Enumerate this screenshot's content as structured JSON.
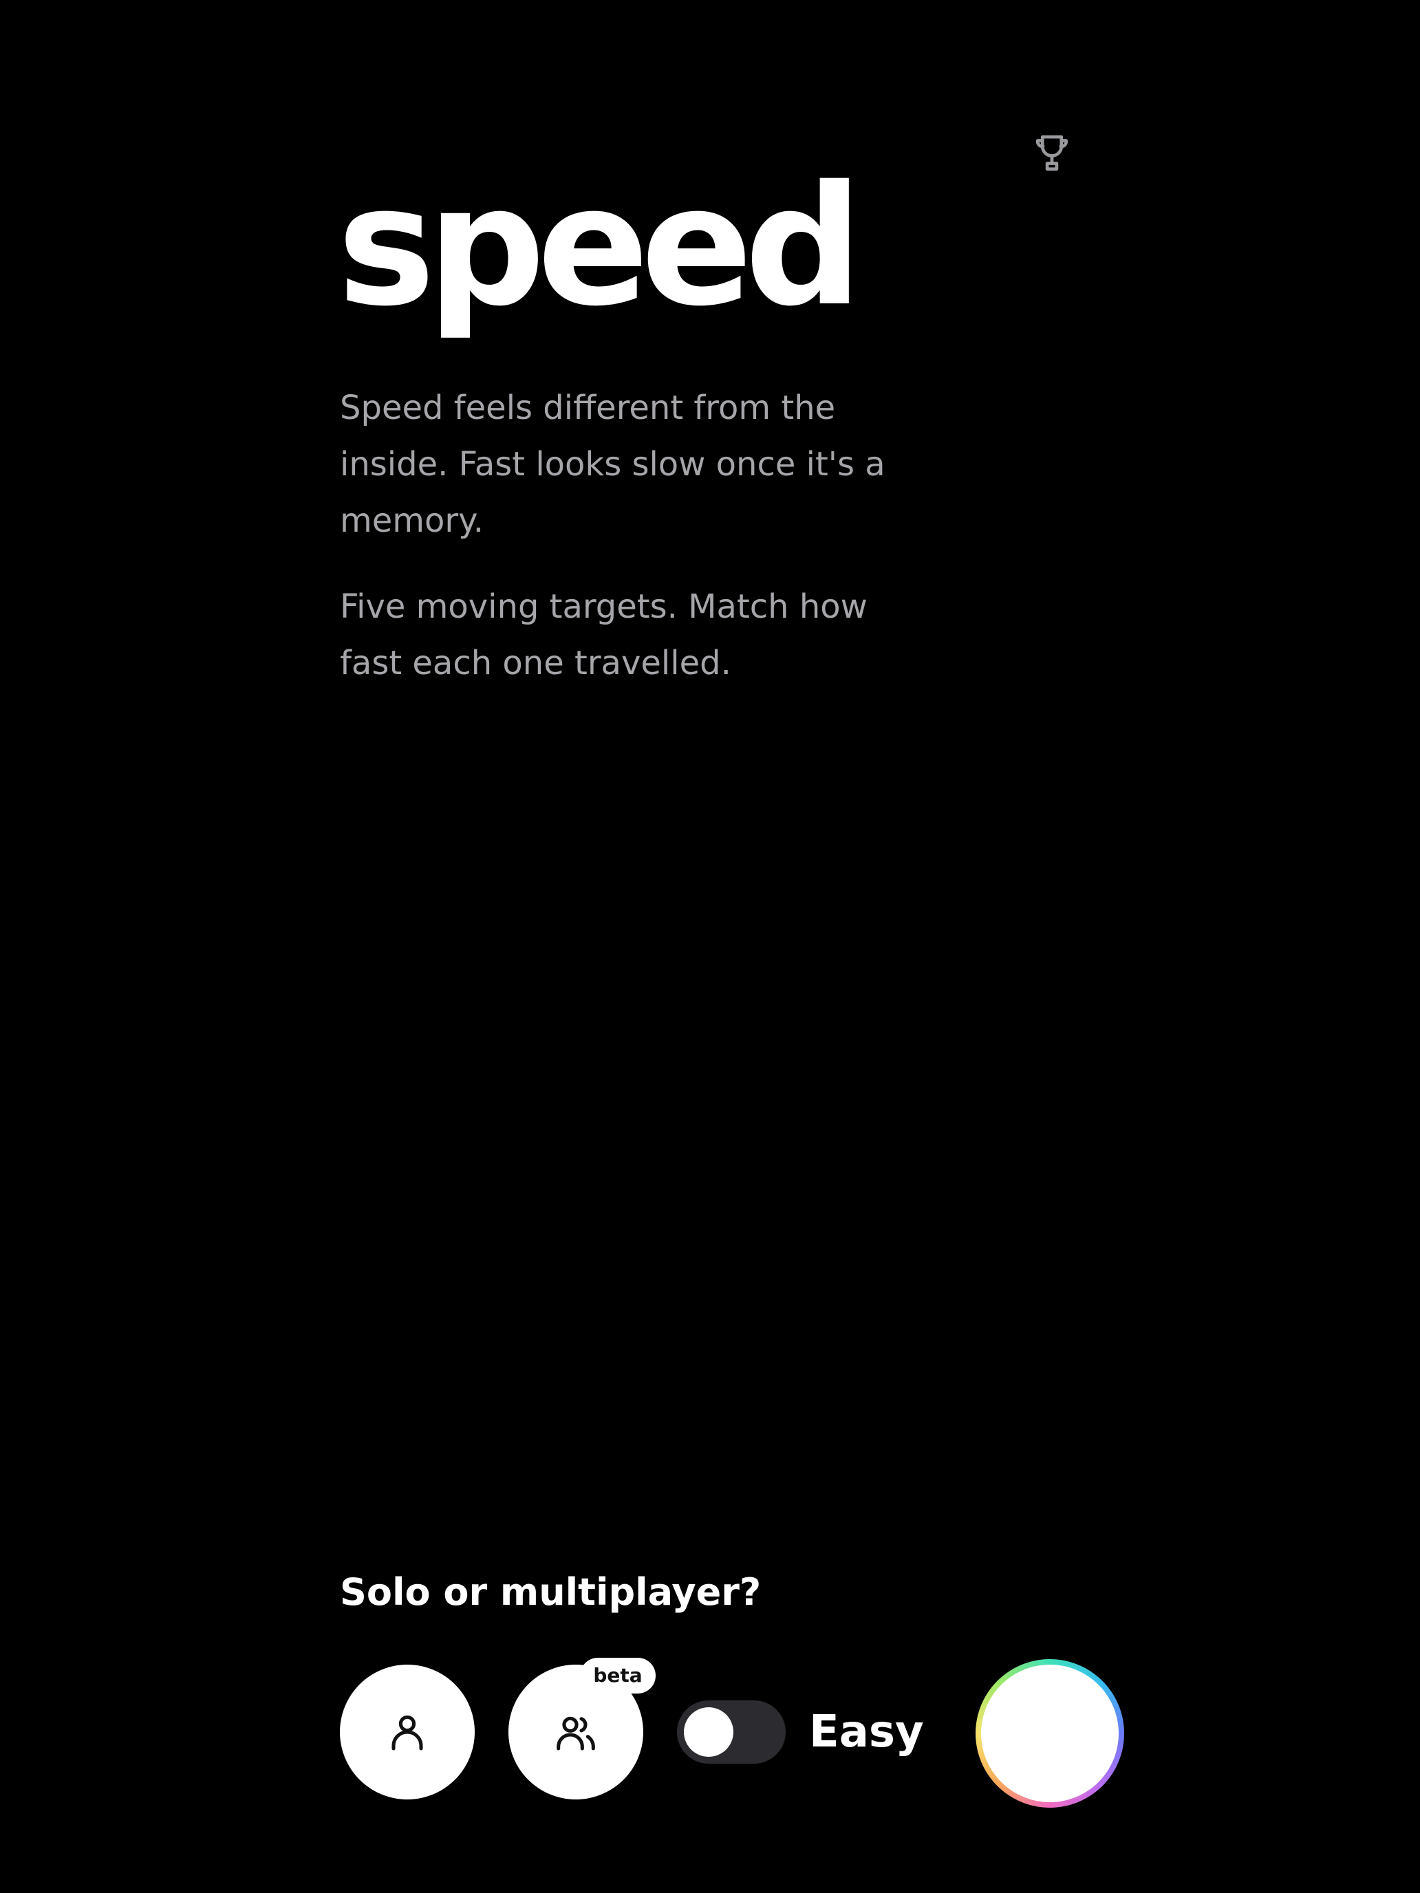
{
  "header": {
    "trophy_icon": "trophy-icon"
  },
  "game": {
    "title": "speed",
    "description_1": "Speed feels different from the inside. Fast looks slow once it's a memory.",
    "description_2": "Five moving targets. Match how fast each one travelled."
  },
  "controls": {
    "prompt": "Solo or multiplayer?",
    "solo_icon": "person-icon",
    "multiplayer_icon": "people-icon",
    "beta_badge": "beta",
    "difficulty_label": "Easy",
    "difficulty_toggle_on": false,
    "start_icon": "rainbow-ring-icon"
  },
  "colors": {
    "background": "#000000",
    "text_primary": "#ffffff",
    "text_secondary": "#a6a6aa",
    "toggle_track": "#2c2c30"
  }
}
